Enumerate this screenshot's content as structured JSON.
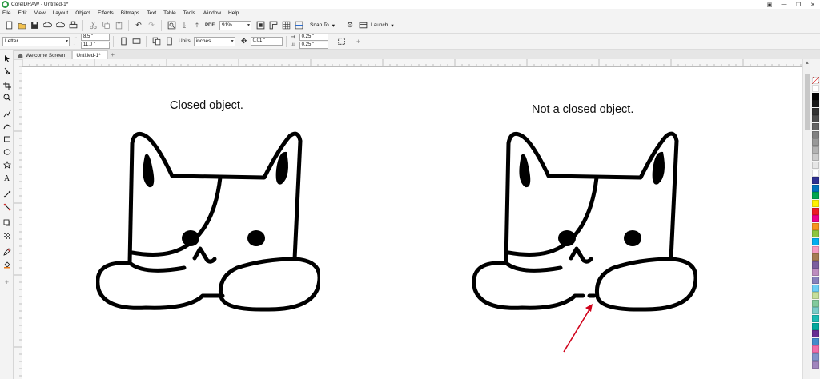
{
  "window": {
    "title": "CorelDRAW - Untitled-1*",
    "controls": {
      "minimize": "—",
      "restore": "❐",
      "close": "✕"
    }
  },
  "menu": [
    "File",
    "Edit",
    "View",
    "Layout",
    "Object",
    "Effects",
    "Bitmaps",
    "Text",
    "Table",
    "Tools",
    "Window",
    "Help"
  ],
  "toolbar": {
    "zoom": "91%",
    "snap_to": "Snap To",
    "launch": "Launch"
  },
  "property_bar": {
    "page_size": "Letter",
    "width": "8.5 \"",
    "height": "11.0 \"",
    "units_label": "Units:",
    "units": "inches",
    "nudge": "0.01 \"",
    "duplicate_x": "0.25 \"",
    "duplicate_y": "0.25 \""
  },
  "tabs": {
    "welcome": "Welcome Screen",
    "document": "Untitled-1*",
    "add": "+"
  },
  "canvas": {
    "left_caption": "Closed object.",
    "right_caption": "Not a closed object."
  },
  "annotation": {
    "arrow_color": "#d0021b"
  },
  "palette": [
    "#ffffff",
    "#000000",
    "#1a1a1a",
    "#333333",
    "#4d4d4d",
    "#666666",
    "#808080",
    "#999999",
    "#b3b3b3",
    "#cccccc",
    "#e6e6e6",
    "#ffffff",
    "#2e3192",
    "#0072bc",
    "#00a651",
    "#fff200",
    "#ed1c24",
    "#ec008c",
    "#f7941d",
    "#8dc63f",
    "#00aeef",
    "#f49ac1",
    "#a67c52",
    "#7b5e9e",
    "#bd8cbf",
    "#8781bd",
    "#6dcff6",
    "#c4df9b",
    "#82ca9c",
    "#7accc8",
    "#1cbbb4",
    "#00a99d",
    "#662d91",
    "#448ccb",
    "#f06eaa",
    "#8393ca",
    "#a186be"
  ]
}
